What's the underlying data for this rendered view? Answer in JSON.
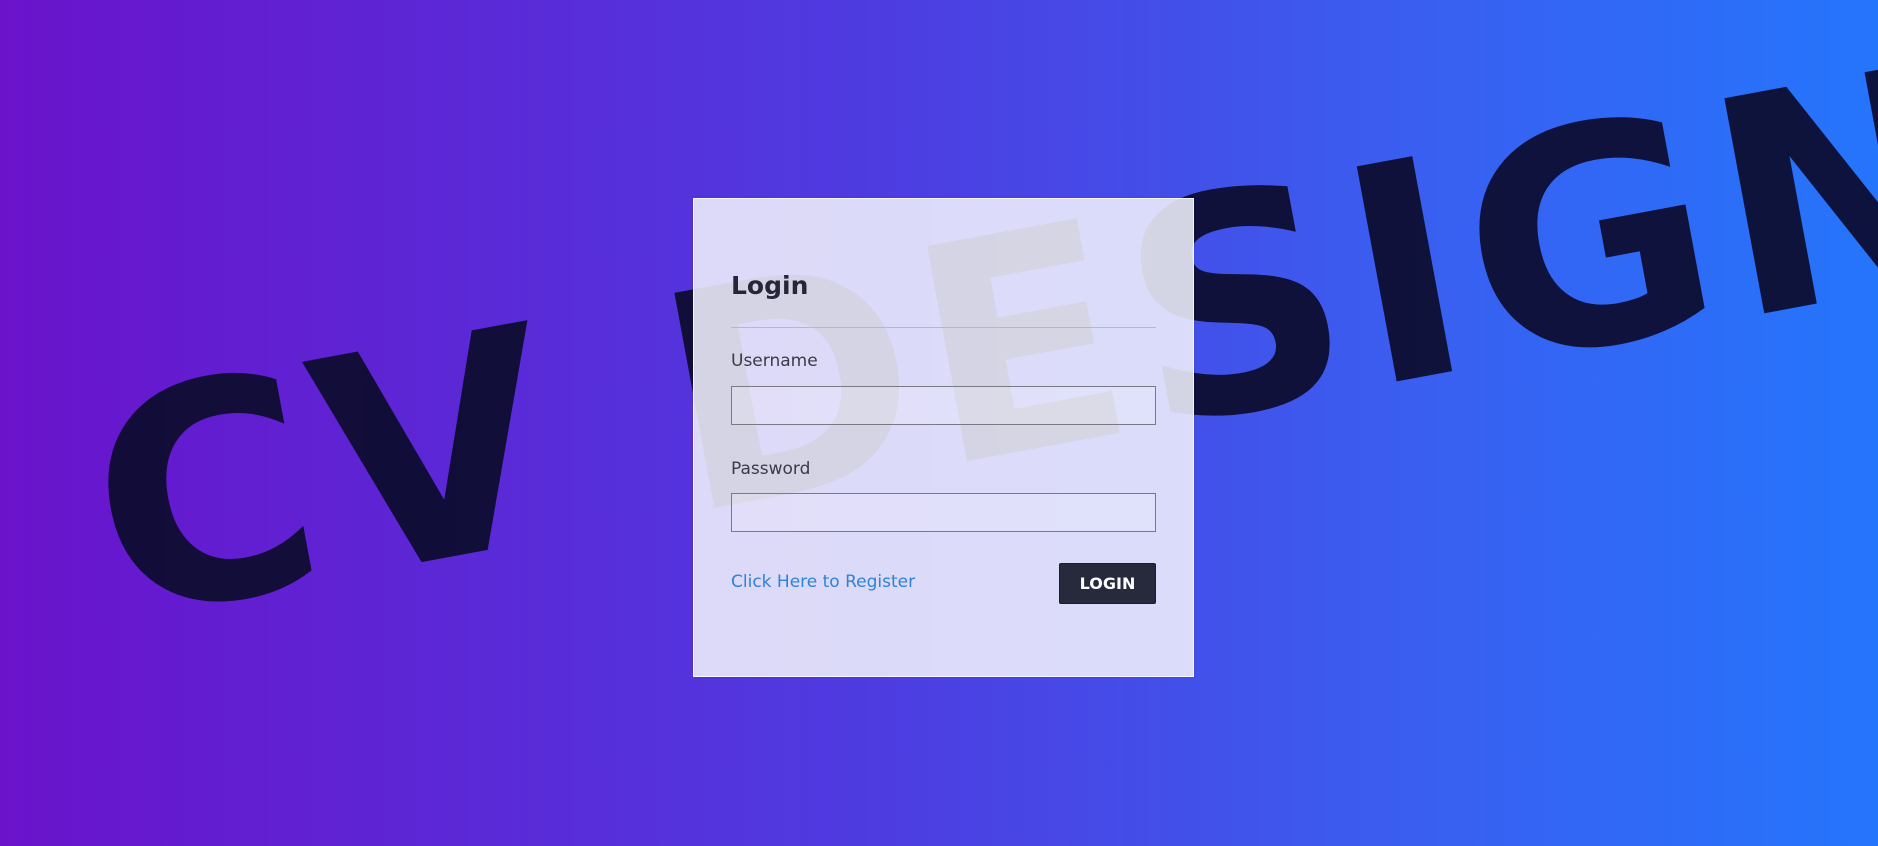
{
  "backdrop": {
    "watermark_text": "CV DESIGN"
  },
  "colors": {
    "gradient_start": "#6a13cb",
    "gradient_end": "#2575fc",
    "button_bg": "#262a3c",
    "link": "#2f82d8"
  },
  "login_form": {
    "title": "Login",
    "username_label": "Username",
    "username_value": "",
    "password_label": "Password",
    "password_value": "",
    "register_link_label": "Click Here to Register",
    "submit_label": "LOGIN"
  }
}
